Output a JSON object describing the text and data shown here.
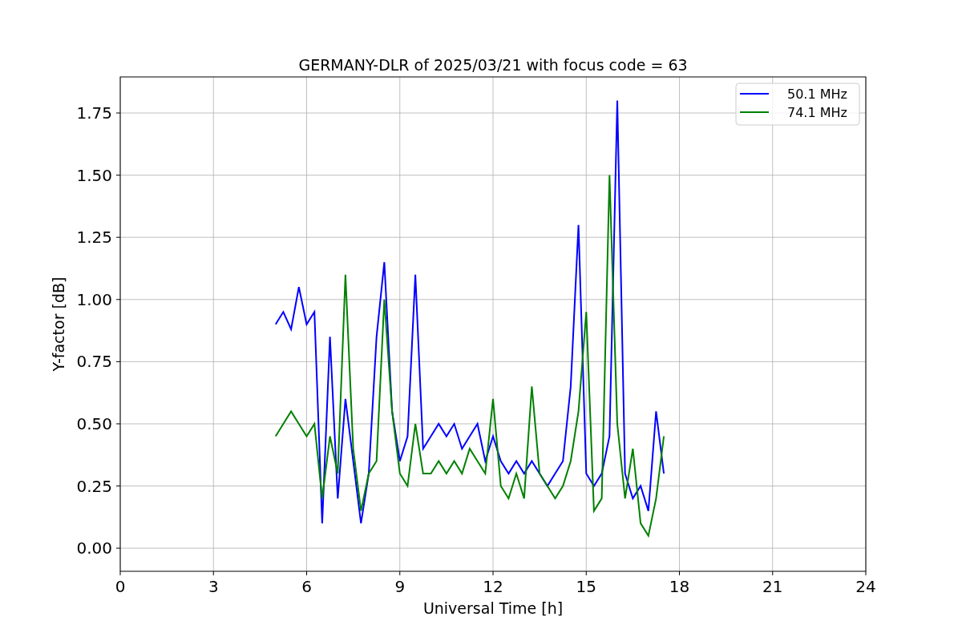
{
  "figure": {
    "chart_data": {
      "type": "line",
      "title": "GERMANY-DLR of 2025/03/21 with focus code = 63",
      "xlabel": "Universal Time [h]",
      "ylabel": "Y-factor [dB]",
      "x": [
        5.0,
        5.25,
        5.5,
        5.75,
        6.0,
        6.25,
        6.5,
        6.75,
        7.0,
        7.25,
        7.5,
        7.75,
        8.0,
        8.25,
        8.5,
        8.75,
        9.0,
        9.25,
        9.5,
        9.75,
        10.0,
        10.25,
        10.5,
        10.75,
        11.0,
        11.25,
        11.5,
        11.75,
        12.0,
        12.25,
        12.5,
        12.75,
        13.0,
        13.25,
        13.5,
        13.75,
        14.0,
        14.25,
        14.5,
        14.75,
        15.0,
        15.25,
        15.5,
        15.75,
        16.0,
        16.25,
        16.5,
        16.75,
        17.0,
        17.25,
        17.5
      ],
      "series": [
        {
          "name": "50.1 MHz",
          "color": "#0000ff",
          "values": [
            0.9,
            0.95,
            0.88,
            1.05,
            0.9,
            0.95,
            0.1,
            0.85,
            0.2,
            0.6,
            0.35,
            0.1,
            0.3,
            0.85,
            1.15,
            0.55,
            0.35,
            0.45,
            1.1,
            0.4,
            0.45,
            0.5,
            0.45,
            0.5,
            0.4,
            0.45,
            0.5,
            0.35,
            0.45,
            0.35,
            0.3,
            0.35,
            0.3,
            0.35,
            0.3,
            0.25,
            0.3,
            0.35,
            0.65,
            1.3,
            0.3,
            0.25,
            0.3,
            0.45,
            1.8,
            0.3,
            0.2,
            0.25,
            0.15,
            0.55,
            0.3
          ]
        },
        {
          "name": "74.1 MHz",
          "color": "#008000",
          "values": [
            0.45,
            0.5,
            0.55,
            0.5,
            0.45,
            0.5,
            0.2,
            0.45,
            0.3,
            1.1,
            0.4,
            0.15,
            0.3,
            0.35,
            1.0,
            0.55,
            0.3,
            0.25,
            0.5,
            0.3,
            0.3,
            0.35,
            0.3,
            0.35,
            0.3,
            0.4,
            0.35,
            0.3,
            0.6,
            0.25,
            0.2,
            0.3,
            0.2,
            0.65,
            0.3,
            0.25,
            0.2,
            0.25,
            0.35,
            0.55,
            0.95,
            0.15,
            0.2,
            1.5,
            0.5,
            0.2,
            0.4,
            0.1,
            0.05,
            0.2,
            0.45
          ]
        }
      ],
      "grid": true,
      "legend": true,
      "xlim": [
        0,
        24
      ],
      "ylim": [
        -0.093,
        1.895
      ],
      "xticks": [
        0,
        3,
        6,
        9,
        12,
        15,
        18,
        21,
        24
      ],
      "yticks": [
        {
          "value": 0,
          "label": "0.00"
        },
        {
          "value": 0.25,
          "label": "0.25"
        },
        {
          "value": 0.5,
          "label": "0.50"
        },
        {
          "value": 0.75,
          "label": "0.75"
        },
        {
          "value": 1,
          "label": "1.00"
        },
        {
          "value": 1.25,
          "label": "1.25"
        },
        {
          "value": 1.5,
          "label": "1.50"
        },
        {
          "value": 1.75,
          "label": "1.75"
        }
      ]
    }
  }
}
